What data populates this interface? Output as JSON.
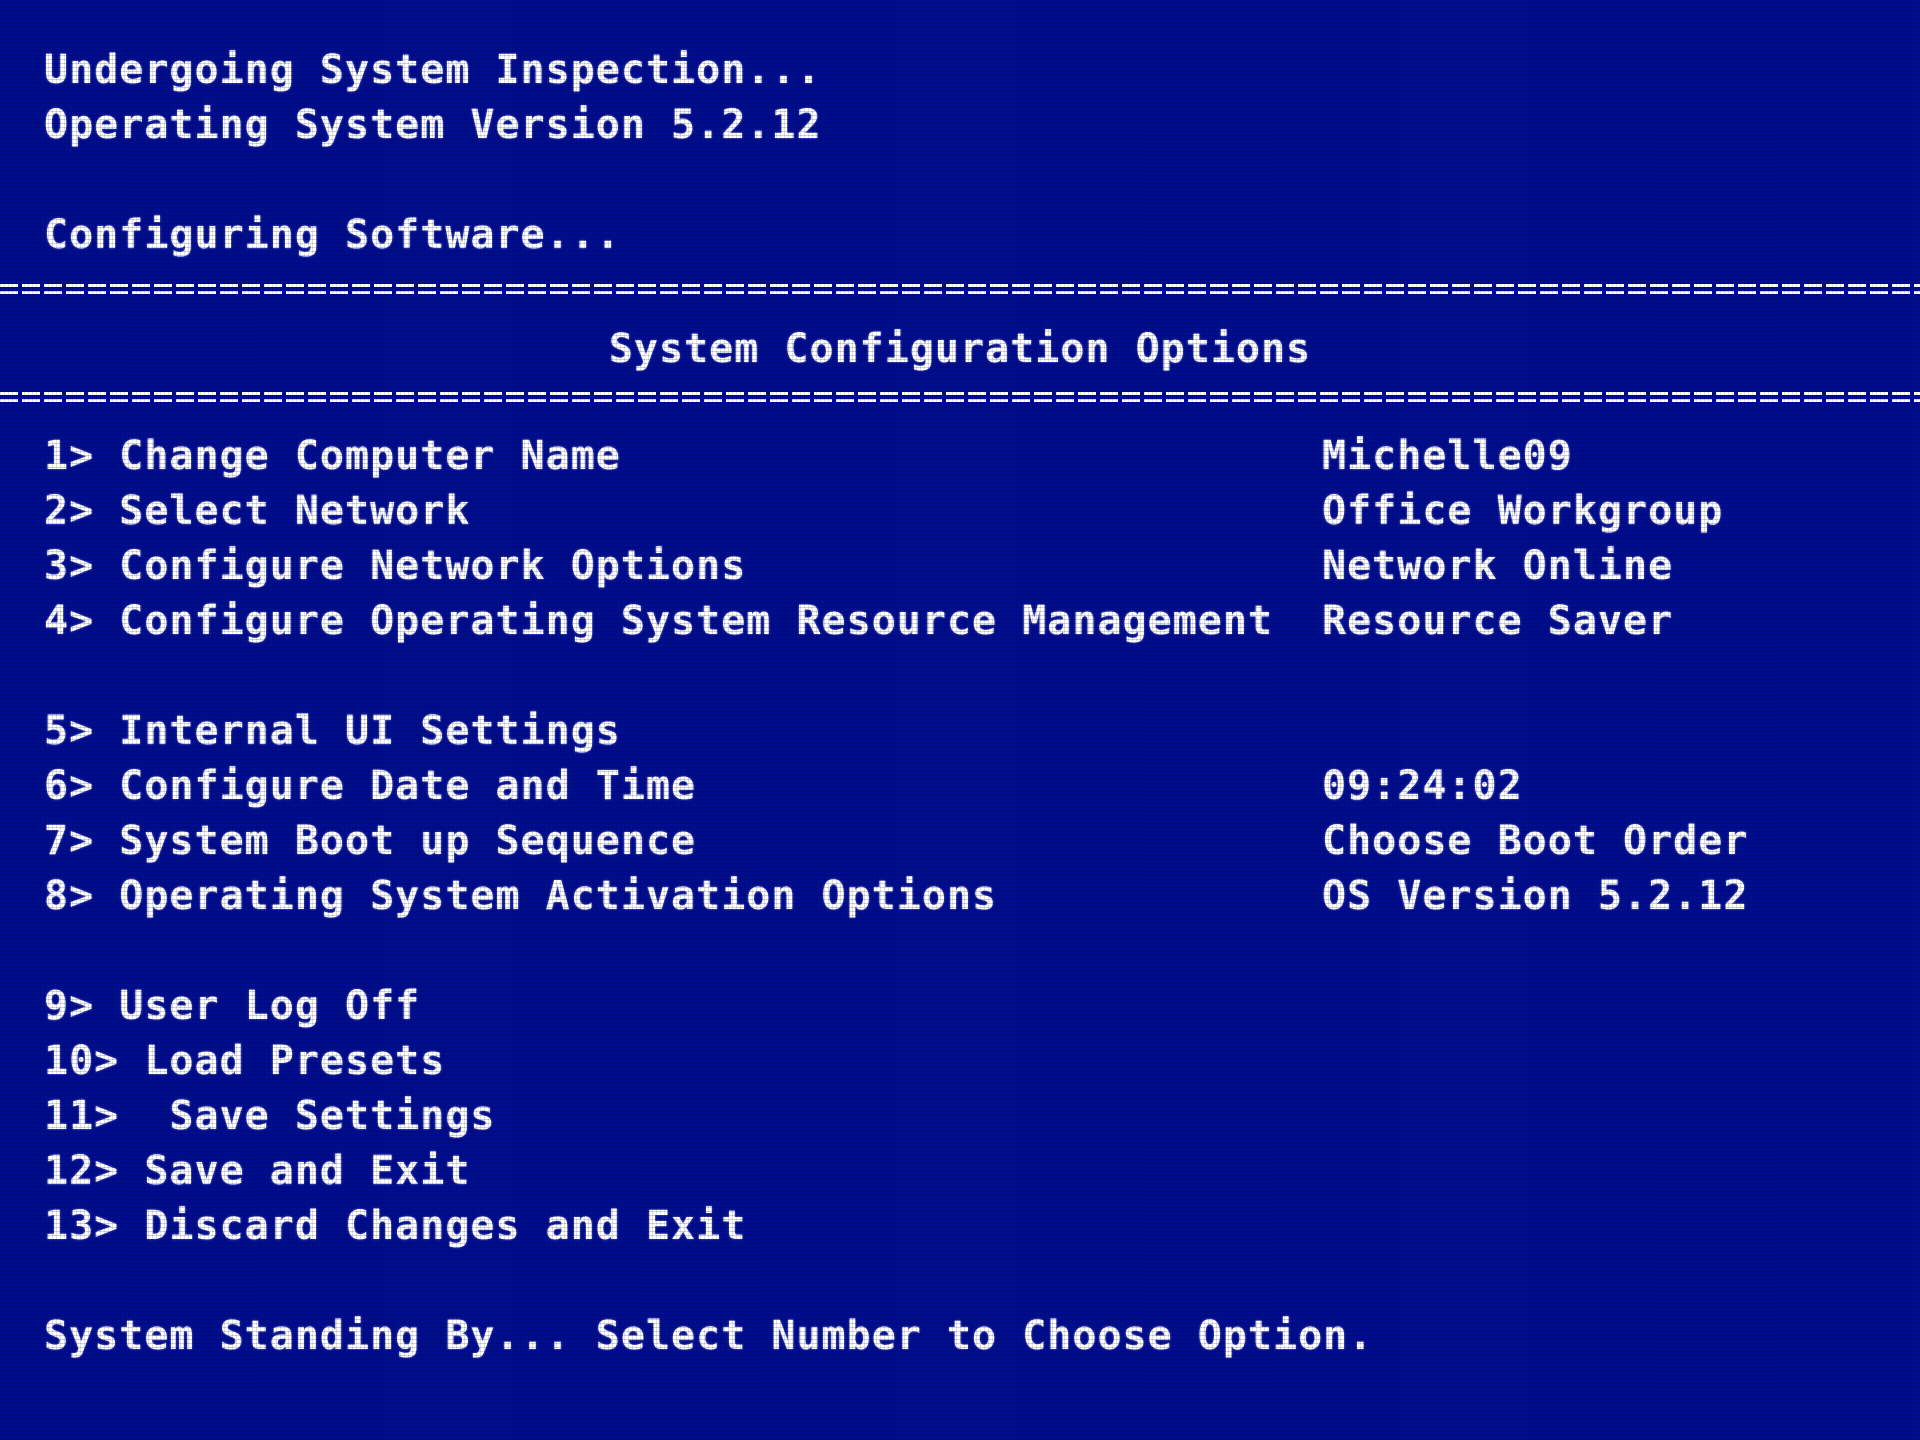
{
  "status": {
    "line1": "Undergoing System Inspection...",
    "line2": "Operating System Version 5.2.12",
    "line3": "Configuring Software..."
  },
  "menu": {
    "heading": "System Configuration Options",
    "items": [
      {
        "label": "1> Change Computer Name",
        "value": "Michelle09"
      },
      {
        "label": "2> Select Network",
        "value": "Office Workgroup"
      },
      {
        "label": "3> Configure Network Options",
        "value": "Network Online"
      },
      {
        "label": "4> Configure Operating System Resource Management",
        "value": "Resource Saver"
      },
      {
        "label": "5> Internal UI Settings",
        "value": ""
      },
      {
        "label": "6> Configure Date and Time",
        "value": "09:24:02"
      },
      {
        "label": "7> System Boot up Sequence",
        "value": "Choose Boot Order"
      },
      {
        "label": "8> Operating System Activation Options",
        "value": "OS Version 5.2.12"
      },
      {
        "label": "9> User Log Off",
        "value": ""
      },
      {
        "label": "10> Load Presets",
        "value": ""
      },
      {
        "label": "11>  Save Settings",
        "value": ""
      },
      {
        "label": "12> Save and Exit",
        "value": ""
      },
      {
        "label": "13> Discard Changes and Exit",
        "value": ""
      }
    ]
  },
  "prompt": "System Standing By... Select Number to Choose Option.",
  "colors": {
    "background": "#000d8f",
    "text": "#ffffff"
  }
}
